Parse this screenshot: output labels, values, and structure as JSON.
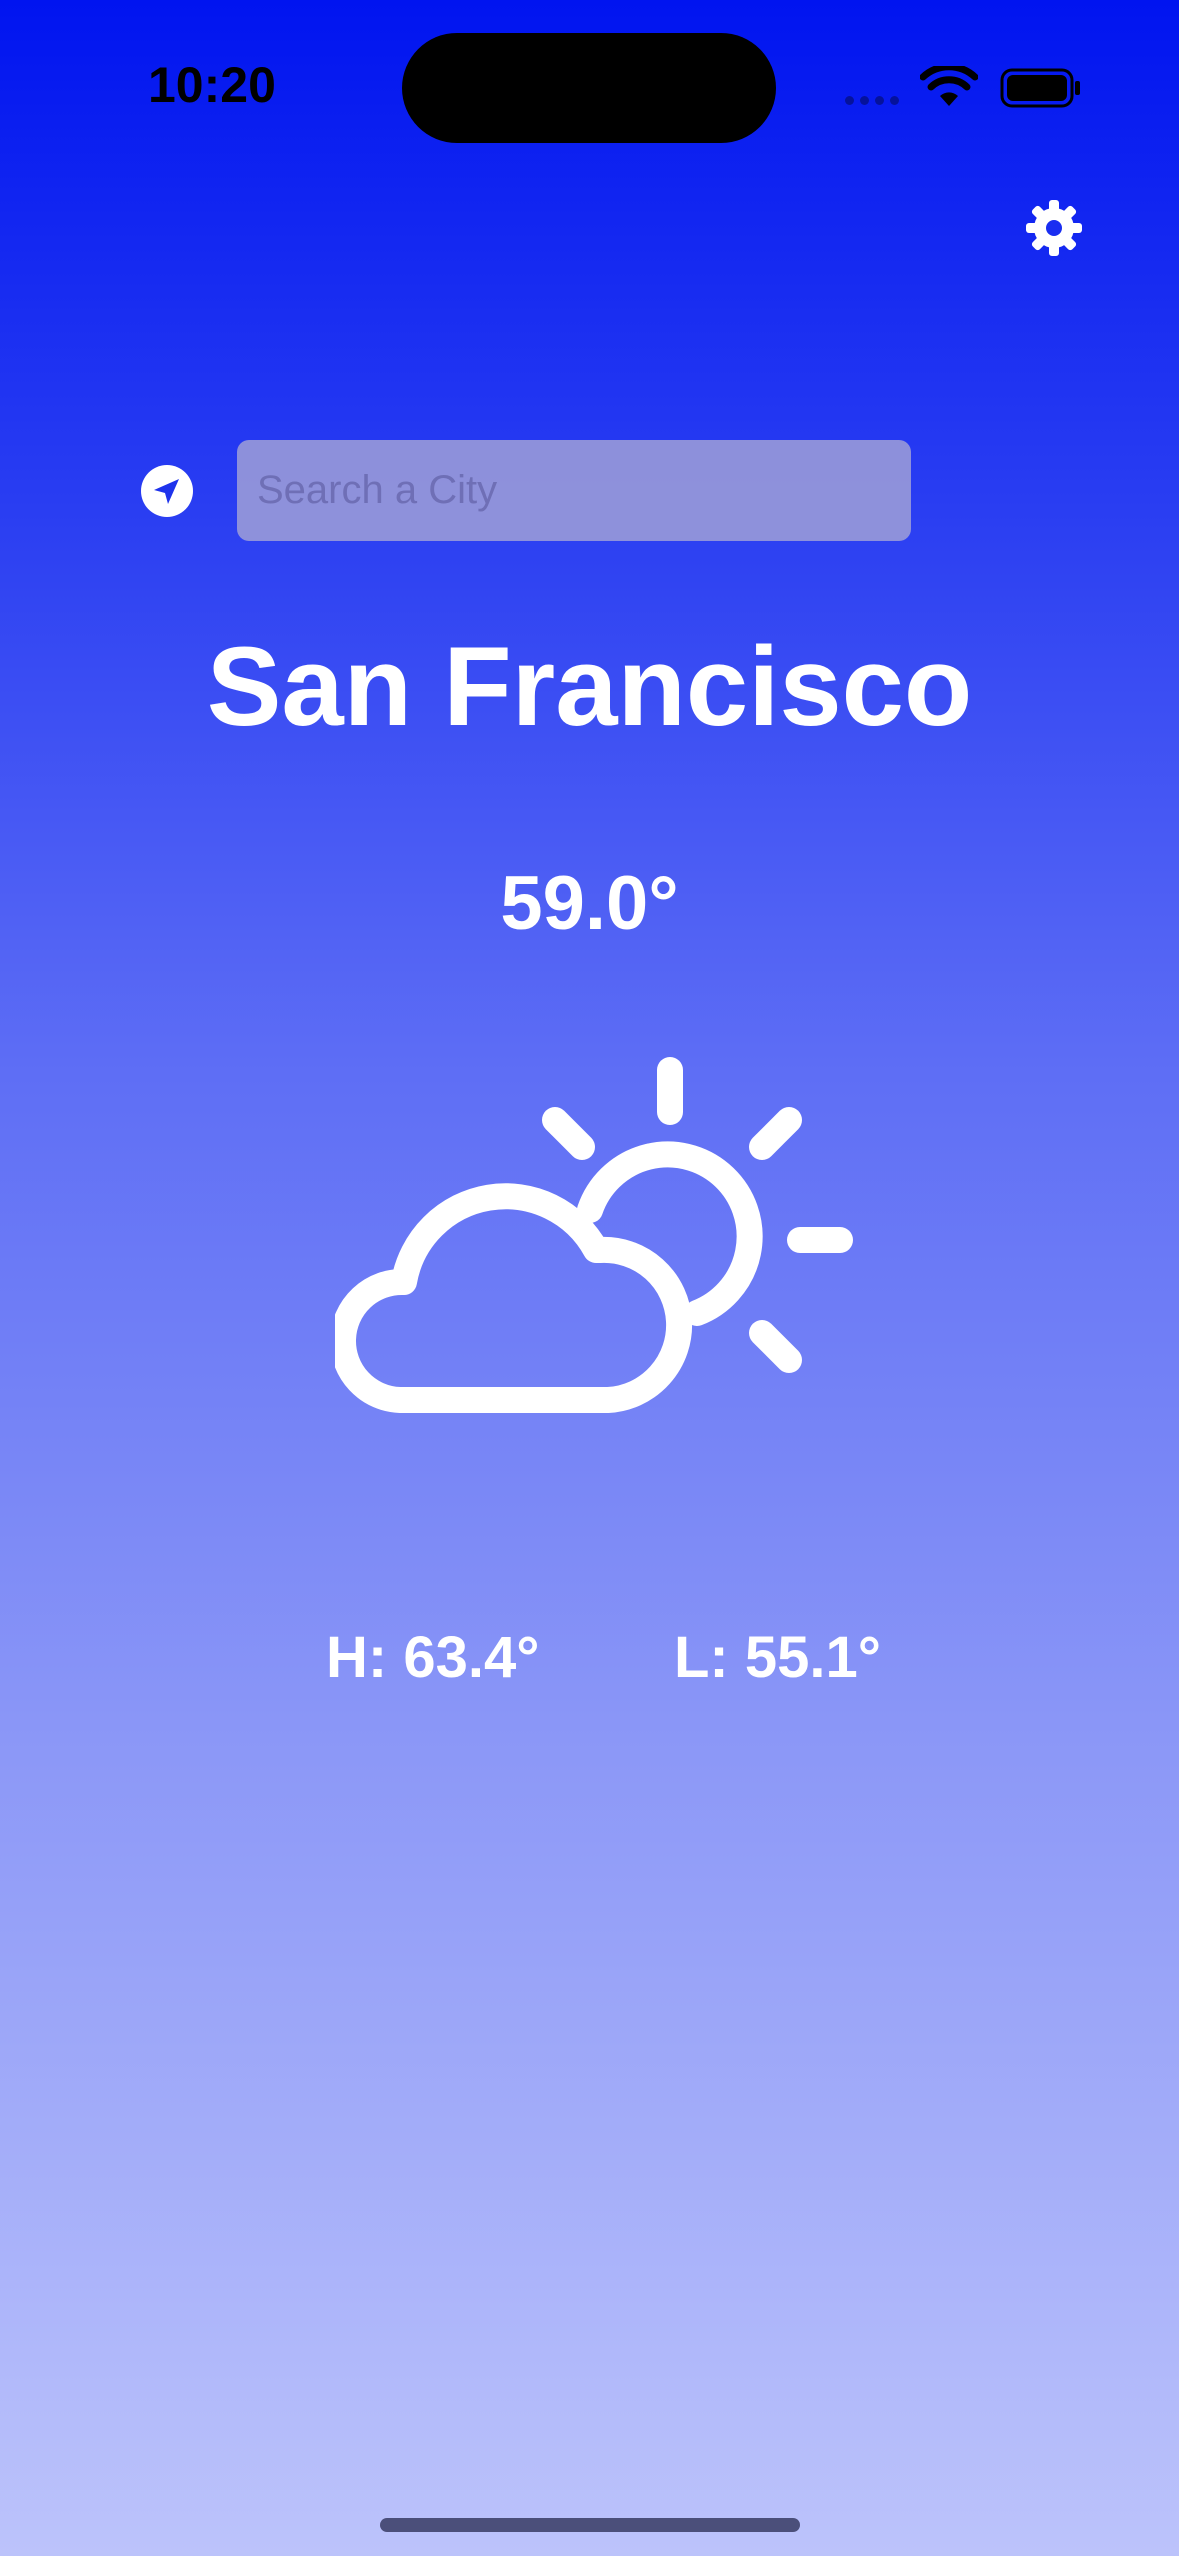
{
  "status_bar": {
    "time": "10:20"
  },
  "search": {
    "placeholder": "Search a City",
    "value": ""
  },
  "weather": {
    "city": "San Francisco",
    "temperature": "59.0°",
    "condition_icon": "partly-cloudy-icon",
    "high": "H: 63.4°",
    "low": "L: 55.1°"
  },
  "icons": {
    "settings": "gear-icon",
    "location": "location-arrow-icon",
    "wifi": "wifi-icon",
    "battery": "battery-icon"
  },
  "colors": {
    "gradient_top": "#0014F0",
    "gradient_bottom": "#BCC3FB",
    "foreground": "#FFFFFF"
  }
}
